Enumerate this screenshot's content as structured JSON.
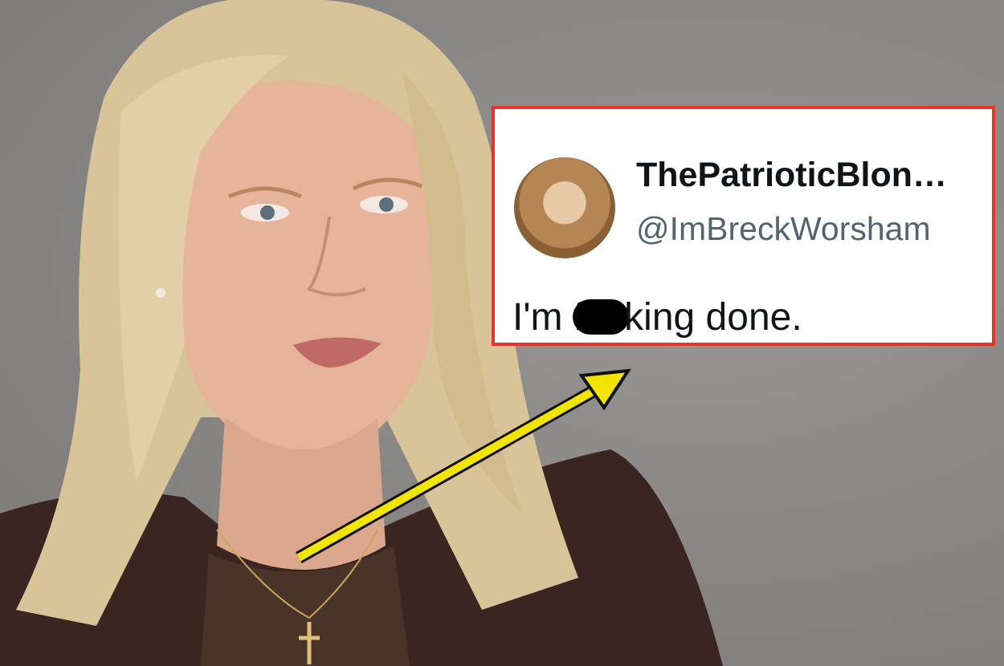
{
  "photo": {
    "subject": "woman-portrait",
    "icon": "person-photo"
  },
  "tweet": {
    "display_name": "ThePatrioticBlon…",
    "handle": "@ImBreckWorsham",
    "text_before_censor": "I'm f",
    "text_after_censor": "king done.",
    "highlight_color": "#e0362b"
  },
  "arrow": {
    "color": "#f2e600"
  }
}
